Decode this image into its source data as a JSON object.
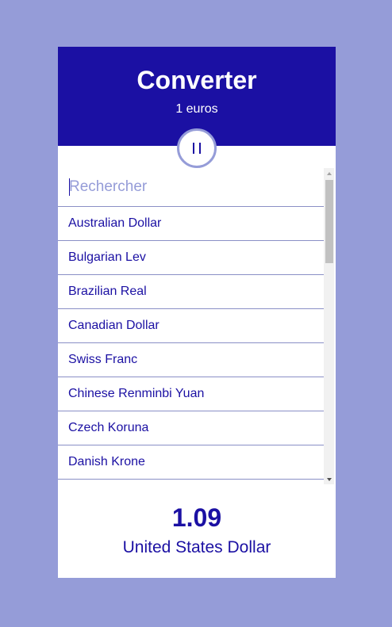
{
  "header": {
    "title": "Converter",
    "subtitle": "1 euros"
  },
  "swap_button": {
    "icon": "pause-icon"
  },
  "search": {
    "placeholder": "Rechercher",
    "value": ""
  },
  "currencies": [
    "Australian Dollar",
    "Bulgarian Lev",
    "Brazilian Real",
    "Canadian Dollar",
    "Swiss Franc",
    "Chinese Renminbi Yuan",
    "Czech Koruna",
    "Danish Krone"
  ],
  "result": {
    "value": "1.09",
    "currency": "United States Dollar"
  },
  "colors": {
    "background": "#959cd8",
    "primary": "#1b10a3",
    "card": "#ffffff"
  }
}
